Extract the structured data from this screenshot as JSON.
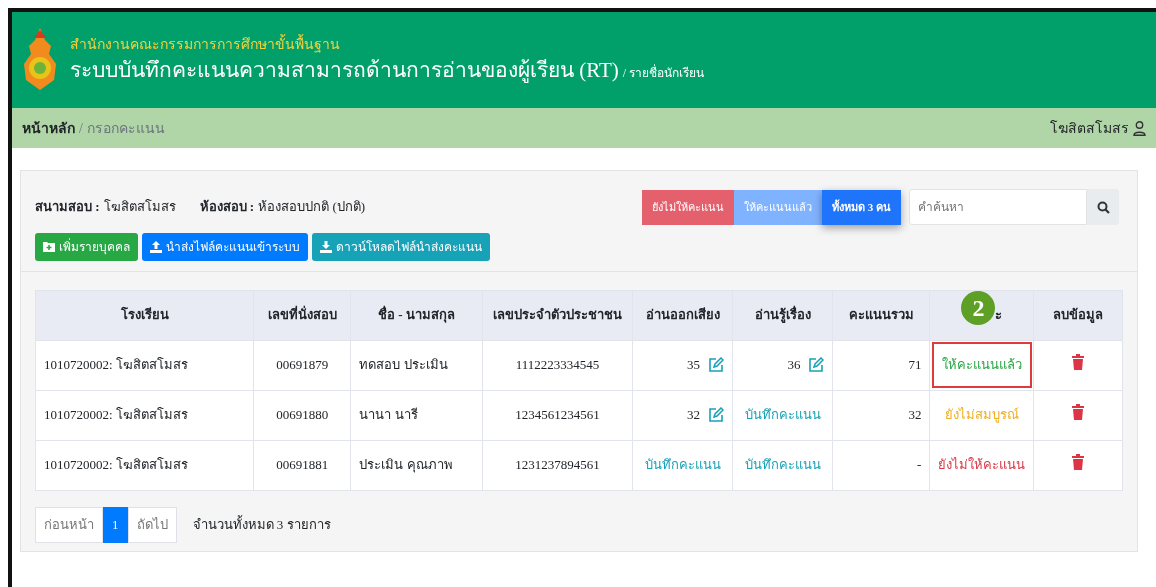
{
  "header": {
    "org": "สำนักงานคณะกรรมการการศึกษาขั้นพื้นฐาน",
    "title": "ระบบบันทึกคะแนนความสามารถด้านการอ่านของผู้เรียน (RT)",
    "subtitle": "/ รายชื่อนักเรียน"
  },
  "breadcrumb_separator": "/",
  "breadcrumb": [
    {
      "label": "หน้าหลัก",
      "current": false
    },
    {
      "label": "กรอกคะแนน",
      "current": true
    }
  ],
  "user": {
    "name": "โฆสิตสโมสร"
  },
  "info": [
    {
      "label": "สนามสอบ :",
      "value": "โฆสิตสโมสร"
    },
    {
      "label": "ห้องสอบ :",
      "value": "ห้องสอบปกติ (ปกติ)"
    }
  ],
  "actions": [
    {
      "label": "เพิ่มรายบุคคล",
      "kind": "add"
    },
    {
      "label": "นำส่งไฟล์คะแนนเข้าระบบ",
      "kind": "upload"
    },
    {
      "label": "ดาวน์โหลดไฟล์นำส่งคะแนน",
      "kind": "download"
    }
  ],
  "filters": [
    {
      "label": "ยังไม่ให้คะแนน",
      "kind": "danger",
      "selected": false
    },
    {
      "label": "ให้คะแนนแล้ว",
      "kind": "light",
      "selected": false
    },
    {
      "label": "ทั้งหมด 3 คน",
      "kind": "primary",
      "selected": true
    }
  ],
  "search": {
    "placeholder": "คำค้นหา"
  },
  "table": {
    "columns": [
      "โรงเรียน",
      "เลขที่นั่งสอบ",
      "ชื่อ - นามสกุล",
      "เลขประจำตัวประชาชน",
      "อ่านออกเสียง",
      "อ่านรู้เรื่อง",
      "คะแนนรวม",
      "ะ",
      "ลบข้อมูล"
    ],
    "rows": [
      {
        "school": "1010720002: โฆสิตสโมสร",
        "seat": "00691879",
        "name": "ทดสอบ ประเมิน",
        "id": "1112223334545",
        "oral": {
          "kind": "score",
          "text": "35"
        },
        "comprehension": {
          "kind": "score",
          "text": "36"
        },
        "total": "71",
        "status": {
          "text": "ให้คะแนนแล้ว",
          "color": "#28a745"
        },
        "highlighted": true
      },
      {
        "school": "1010720002: โฆสิตสโมสร",
        "seat": "00691880",
        "name": "นานา นารี",
        "id": "1234561234561",
        "oral": {
          "kind": "score",
          "text": "32"
        },
        "comprehension": {
          "kind": "link",
          "text": "บันทึกคะแนน"
        },
        "total": "32",
        "status": {
          "text": "ยังไม่สมบูรณ์",
          "color": "#f0ad1e"
        },
        "highlighted": false
      },
      {
        "school": "1010720002: โฆสิตสโมสร",
        "seat": "00691881",
        "name": "ประเมิน คุณภาพ",
        "id": "1231237894561",
        "oral": {
          "kind": "link",
          "text": "บันทึกคะแนน"
        },
        "comprehension": {
          "kind": "link",
          "text": "บันทึกคะแนน"
        },
        "total": "-",
        "status": {
          "text": "ยังไม่ให้คะแนน",
          "color": "#dc3545"
        },
        "highlighted": false
      }
    ]
  },
  "annotation": {
    "label": "2"
  },
  "pagination": [
    {
      "label": "ก่อนหน้า",
      "selected": false
    },
    {
      "label": "1",
      "selected": true
    },
    {
      "label": "ถัดไป",
      "selected": false
    }
  ],
  "summary": "จำนวนทั้งหมด 3 รายการ"
}
